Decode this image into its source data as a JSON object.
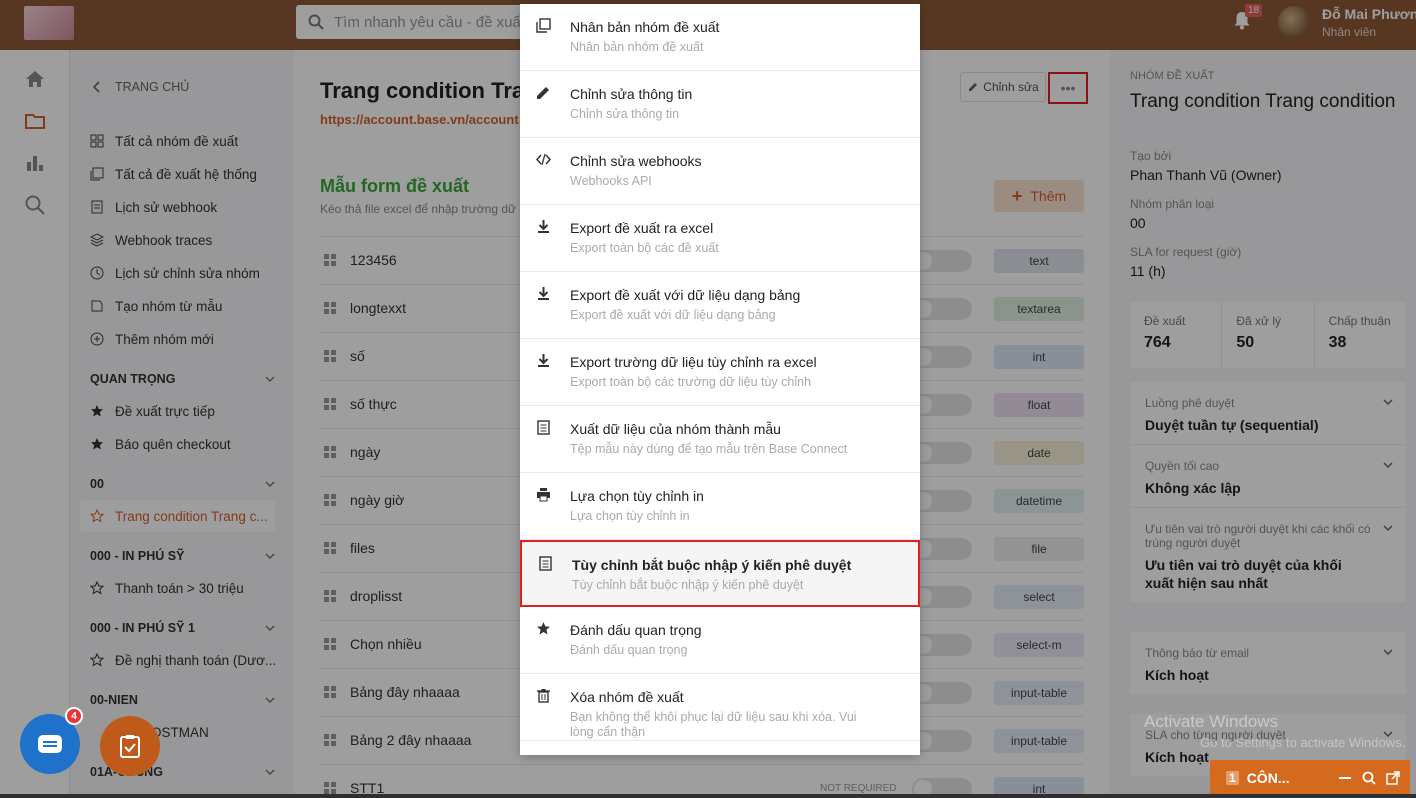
{
  "header": {
    "search_placeholder": "Tìm nhanh yêu cầu - đề xuất",
    "notif_count": "18",
    "user_name": "Đỗ Mai Phương",
    "user_role": "Nhân viên"
  },
  "sidebar": {
    "back_label": "TRANG CHỦ",
    "items": [
      "Tất cả nhóm đề xuất",
      "Tất cả đề xuất hệ thống",
      "Lịch sử webhook",
      "Webhook traces",
      "Lịch sử chỉnh sửa nhóm",
      "Tạo nhóm từ mẫu",
      "Thêm nhóm mới"
    ],
    "sections": [
      {
        "title": "QUAN TRỌNG",
        "items": [
          "Đề xuất trực tiếp",
          "Báo quên checkout"
        ]
      },
      {
        "title": "00",
        "items": [
          "Trang condition Trang c..."
        ]
      },
      {
        "title": "000 - IN PHÚ SỸ",
        "items": [
          "Thanh toán > 30 triệu"
        ]
      },
      {
        "title": "000 - IN PHÚ SỸ 1",
        "items": [
          "Đề nghị thanh toán (Dươ..."
        ]
      },
      {
        "title": "00-NIEN",
        "items": [
          "POSTMAN"
        ]
      },
      {
        "title": "01A-CCCNG",
        "items": []
      }
    ]
  },
  "main": {
    "title": "Trang condition Trang condition",
    "url": "https://account.base.vn/account",
    "edit_label": "Chỉnh sửa",
    "more_label": "•••",
    "form_title": "Mẫu form đề xuất",
    "form_sub": "Kéo thả file excel để nhập trường dữ liệu",
    "add_label": "Thêm",
    "not_required": "NOT REQUIRED",
    "fields": [
      {
        "label": "123456",
        "type": "text",
        "color": "#dfe6ee"
      },
      {
        "label": "longtexxt",
        "type": "textarea",
        "color": "#e1efe1"
      },
      {
        "label": "số",
        "type": "int",
        "color": "#dbe7f6"
      },
      {
        "label": "số thực",
        "type": "float",
        "color": "#ece1f3"
      },
      {
        "label": "ngày",
        "type": "date",
        "color": "#f6efd8"
      },
      {
        "label": "ngày giờ",
        "type": "datetime",
        "color": "#e0f1f1"
      },
      {
        "label": "files",
        "type": "file",
        "color": "#eeeeee"
      },
      {
        "label": "droplisst",
        "type": "select",
        "color": "#e6eef7"
      },
      {
        "label": "Chọn nhiều",
        "type": "select-m",
        "color": "#e7e8f7"
      },
      {
        "label": "Bảng đây nhaaaa",
        "type": "input-table",
        "color": "#e6eef7"
      },
      {
        "label": "Bảng 2 đây nhaaaa",
        "type": "input-table",
        "color": "#e6eef7"
      },
      {
        "label": "STT1",
        "type": "int",
        "color": "#dbe7f6"
      }
    ]
  },
  "menu": {
    "items": [
      {
        "title": "Nhân bản nhóm đề xuất",
        "sub": "Nhân bản nhóm đề xuất",
        "icon": "copy-icon"
      },
      {
        "title": "Chỉnh sửa thông tin",
        "sub": "Chỉnh sửa thông tin",
        "icon": "pencil-icon"
      },
      {
        "title": "Chỉnh sửa webhooks",
        "sub": "Webhooks API",
        "icon": "code-icon"
      },
      {
        "title": "Export đề xuất ra excel",
        "sub": "Export toàn bộ các đề xuất",
        "icon": "download-icon"
      },
      {
        "title": "Export đề xuất với dữ liệu dạng bảng",
        "sub": "Export đề xuất với dữ liệu dạng bảng",
        "icon": "download-icon"
      },
      {
        "title": "Export trường dữ liệu tùy chỉnh ra excel",
        "sub": "Export toàn bộ các trường dữ liệu tùy chỉnh",
        "icon": "download-icon"
      },
      {
        "title": "Xuất dữ liệu của nhóm thành mẫu",
        "sub": "Tệp mẫu này dùng để tạo mẫu trên Base Connect",
        "icon": "document-icon"
      },
      {
        "title": "Lựa chọn tùy chỉnh in",
        "sub": "Lựa chọn tùy chỉnh in",
        "icon": "printer-icon"
      },
      {
        "title": "Tùy chỉnh bắt buộc nhập ý kiến phê duyệt",
        "sub": "Tùy chỉnh bắt buộc nhập ý kiến phê duyệt",
        "icon": "document-icon"
      },
      {
        "title": "Đánh dấu quan trọng",
        "sub": "Đánh dấu quan trọng",
        "icon": "star-icon"
      },
      {
        "title": "Xóa nhóm đề xuất",
        "sub": "Bạn không thể khôi phục lại dữ liệu sau khi xóa. Vui lòng cẩn thận",
        "icon": "trash-icon"
      }
    ]
  },
  "panel": {
    "group_label": "NHÓM ĐỀ XUẤT",
    "group_title": "Trang condition Trang condition",
    "created_by_label": "Tạo bởi",
    "created_by": "Phan Thanh Vũ (Owner)",
    "category_label": "Nhóm phân loại",
    "category": "00",
    "sla_label": "SLA for request (giờ)",
    "sla": "11 (h)",
    "stats": [
      {
        "label": "Đề xuất",
        "value": "764"
      },
      {
        "label": "Đã xử lý",
        "value": "50"
      },
      {
        "label": "Chấp thuận",
        "value": "38"
      }
    ],
    "card1": [
      {
        "label": "Luồng phê duyệt",
        "value": "Duyệt tuần tự (sequential)"
      },
      {
        "label": "Quyền tối cao",
        "value": "Không xác lập"
      },
      {
        "label": "Ưu tiên vai trò người duyệt khi các khối có trùng người duyệt",
        "value": "Ưu tiên vai trò duyệt của khối xuất hiện sau nhất"
      }
    ],
    "card2": [
      {
        "label": "Thông báo từ email",
        "value": "Kích hoạt"
      }
    ],
    "card3": [
      {
        "label": "SLA cho từng người duyệt",
        "value": "Kích hoạt"
      }
    ],
    "watermark_title": "Activate Windows",
    "watermark_sub": "Go to Settings to activate Windows."
  },
  "fabs": {
    "chat_badge": "4"
  },
  "bottom_tab": {
    "count": "1",
    "label": "CÔN..."
  },
  "colors": {
    "topbar": "#8d5a37",
    "accent": "#d4602a",
    "highlight": "#e32020",
    "green": "#3aa53a"
  }
}
